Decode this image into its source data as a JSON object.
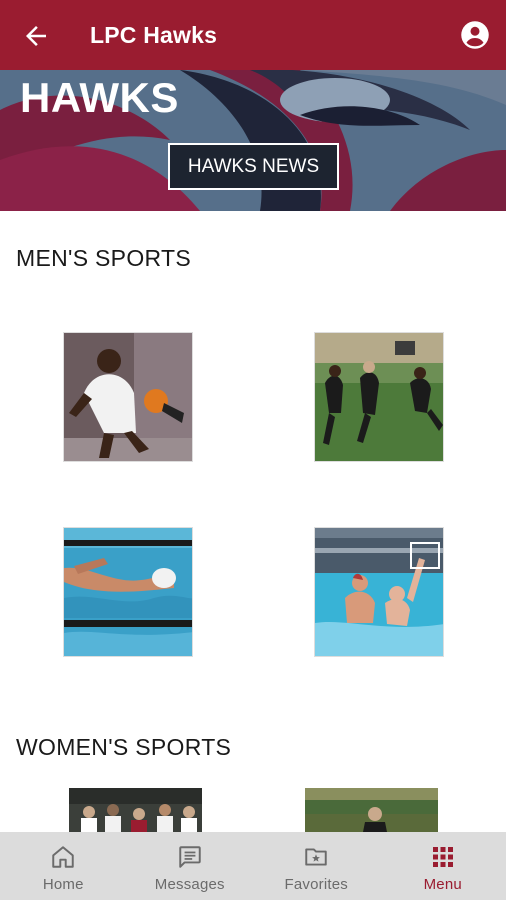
{
  "app_bar": {
    "title": "LPC Hawks",
    "back_icon": "arrow-left-icon",
    "account_icon": "account-circle-icon",
    "color": "#9a1c30"
  },
  "hero": {
    "title": "HAWKS",
    "button_label": "HAWKS NEWS"
  },
  "mens_sports": {
    "title": "MEN'S SPORTS",
    "tiles": [
      {
        "name": "basketball",
        "icon": "basketball-photo"
      },
      {
        "name": "soccer",
        "icon": "soccer-photo"
      },
      {
        "name": "swimming",
        "icon": "swimming-photo"
      },
      {
        "name": "water-polo",
        "icon": "water-polo-photo"
      }
    ]
  },
  "womens_sports": {
    "title": "WOMEN'S SPORTS",
    "tiles": [
      {
        "name": "volleyball",
        "icon": "team-photo"
      },
      {
        "name": "soccer",
        "icon": "field-photo"
      }
    ]
  },
  "bottom_nav": {
    "items": [
      {
        "label": "Home",
        "icon": "home-icon",
        "active": false
      },
      {
        "label": "Messages",
        "icon": "message-icon",
        "active": false
      },
      {
        "label": "Favorites",
        "icon": "star-folder-icon",
        "active": false
      },
      {
        "label": "Menu",
        "icon": "grid-menu-icon",
        "active": true
      }
    ],
    "active_color": "#9a1c30"
  }
}
